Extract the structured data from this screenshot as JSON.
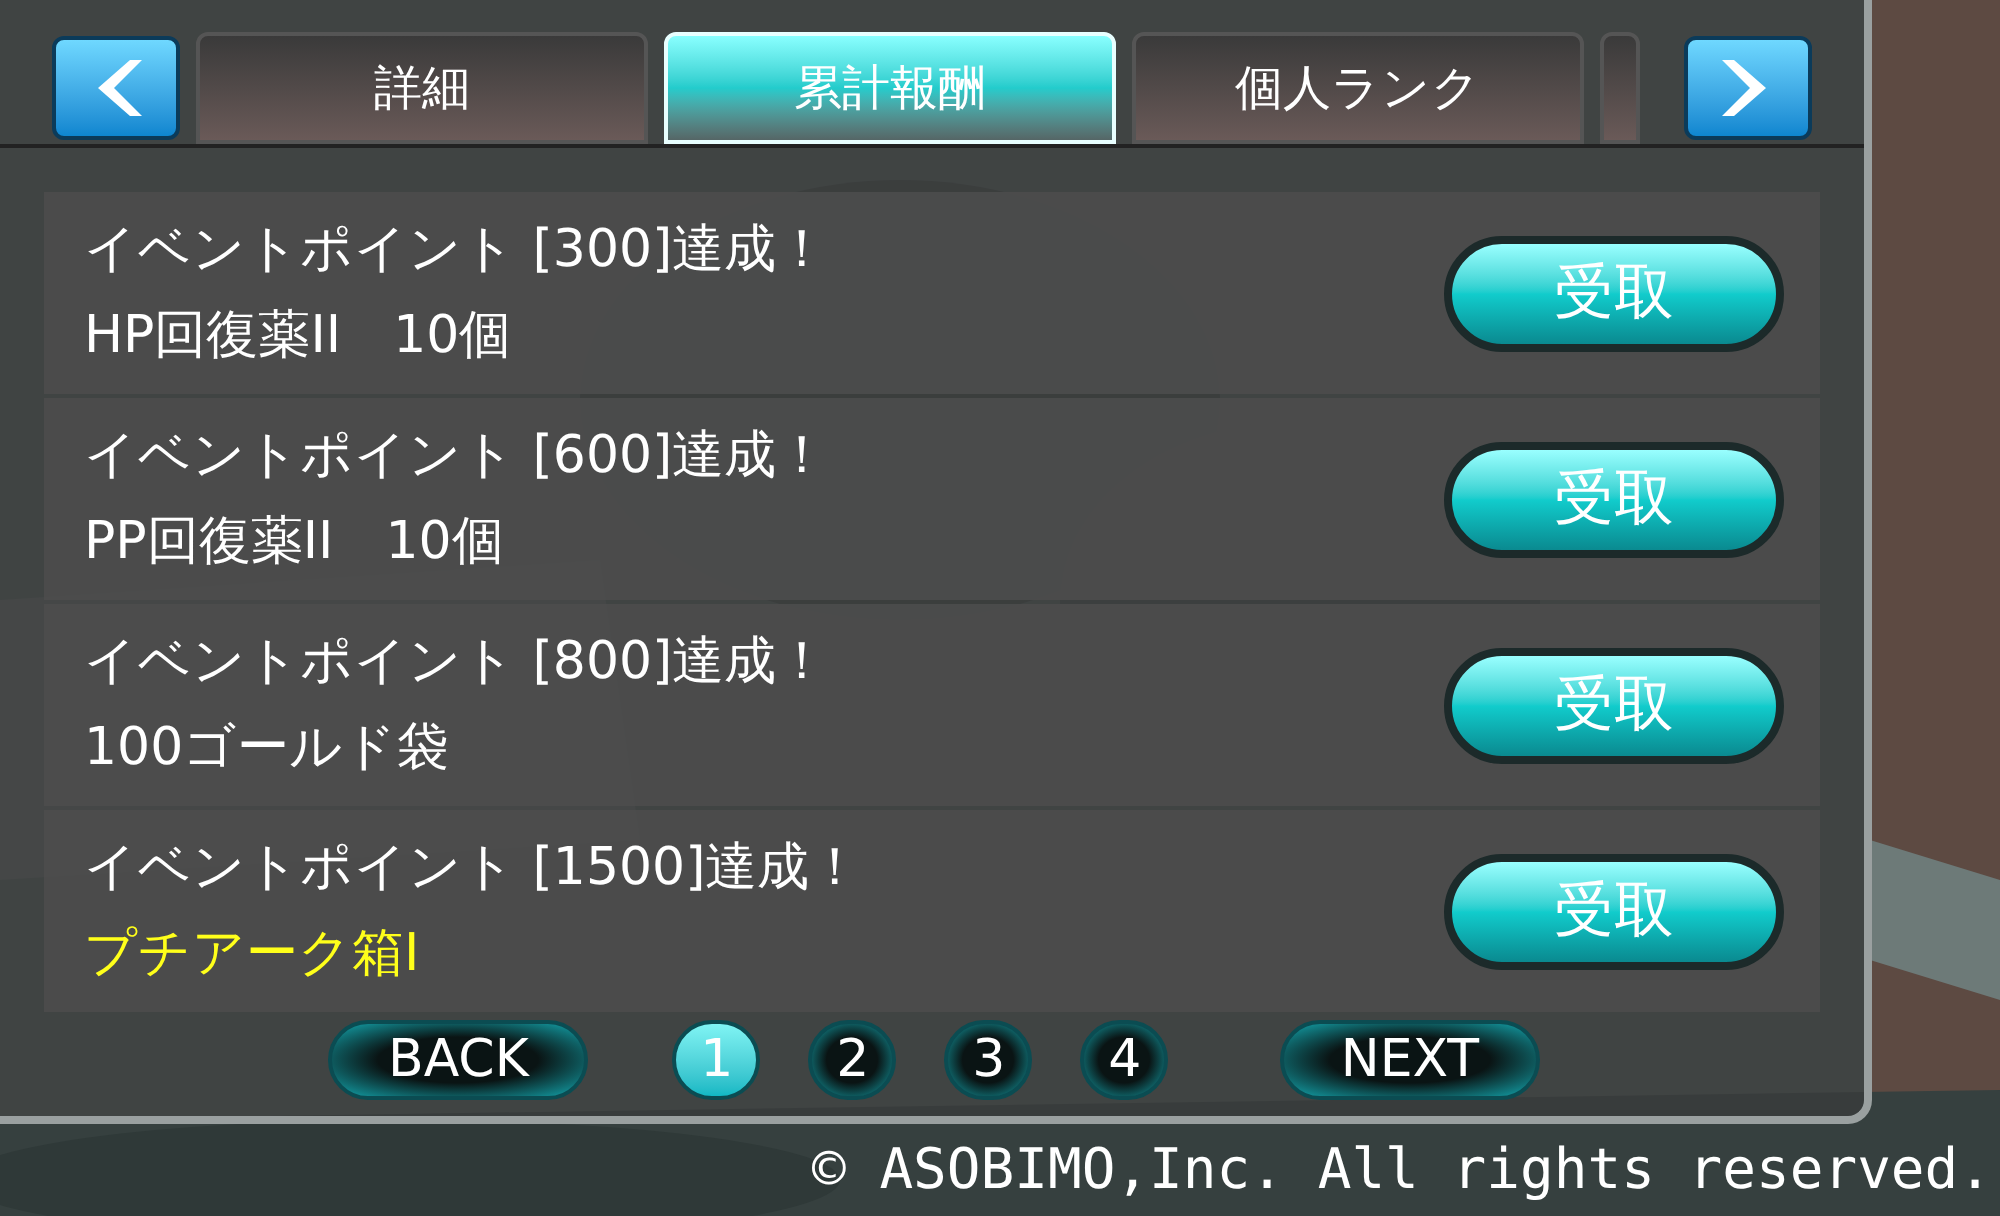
{
  "tabs": [
    {
      "label": "詳細",
      "selected": false
    },
    {
      "label": "累計報酬",
      "selected": true
    },
    {
      "label": "個人ランク",
      "selected": false
    },
    {
      "selected": false
    }
  ],
  "rewards": [
    {
      "title": "イベントポイント [300]達成！",
      "item": "HP回復薬II　10個",
      "highlight": false,
      "button": "受取"
    },
    {
      "title": "イベントポイント [600]達成！",
      "item": "PP回復薬II　10個",
      "highlight": false,
      "button": "受取"
    },
    {
      "title": "イベントポイント [800]達成！",
      "item": "100ゴールド袋",
      "highlight": false,
      "button": "受取"
    },
    {
      "title": "イベントポイント [1500]達成！",
      "item": "プチアーク箱I",
      "highlight": true,
      "button": "受取"
    }
  ],
  "pagination": {
    "back": "BACK",
    "pages": [
      {
        "label": "1",
        "selected": true
      },
      {
        "label": "2",
        "selected": false
      },
      {
        "label": "3",
        "selected": false
      },
      {
        "label": "4",
        "selected": false
      }
    ],
    "next": "NEXT"
  },
  "copyright": "© ASOBIMO,Inc. All rights reserved."
}
